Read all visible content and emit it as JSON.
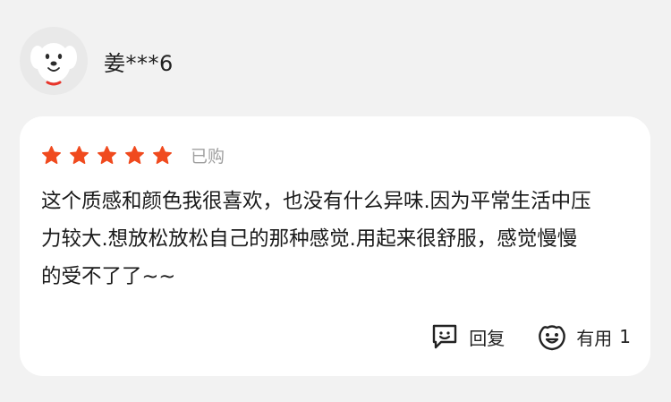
{
  "user": {
    "name": "姜***6",
    "avatar_icon": "dog-mascot-icon"
  },
  "review": {
    "rating": 5,
    "max_rating": 5,
    "star_color": "#f04a1e",
    "purchased_label": "已购",
    "text": "这个质感和颜色我很喜欢，也没有什么异味.因为平常生活中压力较大.想放松放松自己的那种感觉.用起来很舒服，感觉慢慢的受不了了~~"
  },
  "actions": {
    "reply_icon": "comment-icon",
    "reply_label": "回复",
    "helpful_icon": "thumbs-up-face-icon",
    "helpful_label": "有用",
    "helpful_count": "1"
  }
}
